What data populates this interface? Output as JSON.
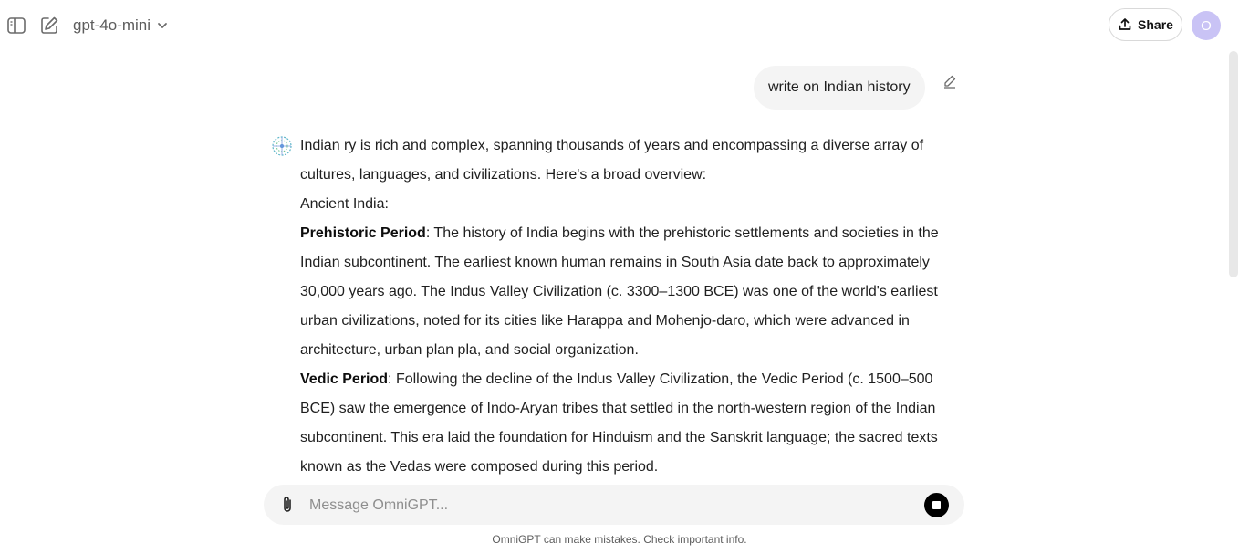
{
  "header": {
    "model_name": "gpt-4o-mini",
    "share_label": "Share",
    "avatar_initial": "O"
  },
  "user_message": {
    "text": "write on Indian history"
  },
  "assistant_message": {
    "paragraph_1": "Indian ry is rich and complex, spanning thousands of years and encompassing a diverse array of cultures, languages, and civilizations. Here's a broad overview:",
    "paragraph_2": "Ancient India:",
    "section_1": {
      "heading": "Prehistoric Period",
      "body": ": The history of India begins with the prehistoric settlements and societies in the Indian subcontinent. The earliest known human remains in South Asia date back to approximately 30,000 years ago. The Indus Valley Civilization (c. 3300–1300 BCE) was one of the world's earliest urban civilizations, noted for its cities like Harappa and Mohenjo-daro, which were advanced in architecture, urban plan pla, and social organization."
    },
    "section_2": {
      "heading": "Vedic Period",
      "body": ": Following the decline of the Indus Valley Civilization, the Vedic Period (c. 1500–500 BCE) saw the emergence of Indo-Aryan tribes that settled in the north-western region of the Indian subcontinent. This era laid the foundation for Hinduism and the Sanskrit language; the sacred texts known as the Vedas were composed during this period."
    }
  },
  "composer": {
    "placeholder": "Message OmniGPT..."
  },
  "footer": {
    "disclaimer": "OmniGPT can make mistakes. Check important info."
  },
  "colors": {
    "avatar_bg": "#c9c3f5",
    "bubble_bg": "#f4f4f4",
    "stop_button": "#000000"
  },
  "icons": {
    "sidebar_toggle": "sidebar-toggle-icon",
    "new_chat": "edit-square-icon",
    "model_chevron": "chevron-down-icon",
    "share": "upload-icon",
    "edit_message": "pencil-icon",
    "assistant": "omnigpt-logo-icon",
    "attach": "paperclip-icon",
    "stop": "stop-icon"
  }
}
